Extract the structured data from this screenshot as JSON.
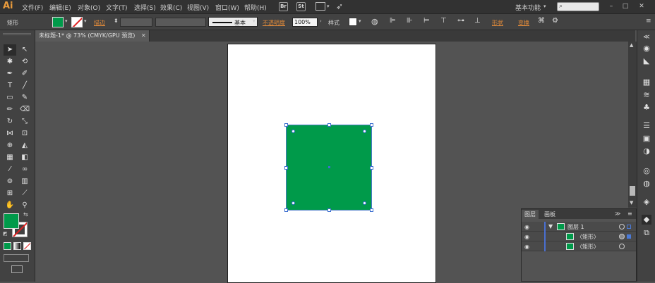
{
  "app": {
    "logo": "Ai",
    "menu": [
      "文件(F)",
      "编辑(E)",
      "对象(O)",
      "文字(T)",
      "选择(S)",
      "效果(C)",
      "视图(V)",
      "窗口(W)",
      "帮助(H)"
    ],
    "bridge_icon": "Br",
    "stock_icon": "St",
    "workspace": "基本功能",
    "window_buttons": [
      "–",
      "□",
      "✕"
    ]
  },
  "control_bar": {
    "object_type": "矩形",
    "stroke_label": "描边",
    "stroke_style": "基本",
    "opacity_label": "不透明度",
    "opacity_value": "100%",
    "style_label": "样式",
    "shape_label": "形状",
    "transform_label": "变换",
    "fill_color": "#009a4a"
  },
  "document": {
    "tab_title": "未标题-1* @ 73% (CMYK/GPU 预览)",
    "close": "✕"
  },
  "colors": {
    "fill": "#009a4a",
    "accent": "#e89a3c",
    "selection": "#3d6fd0"
  },
  "layers_panel": {
    "tabs": [
      "图层",
      "画板"
    ],
    "rows": [
      {
        "name": "图层 1",
        "eye": "◉",
        "expand": "▼"
      },
      {
        "name": "〈矩形〉",
        "eye": "◉"
      },
      {
        "name": "〈矩形〉",
        "eye": "◉"
      }
    ],
    "menu_icon": "≫"
  }
}
